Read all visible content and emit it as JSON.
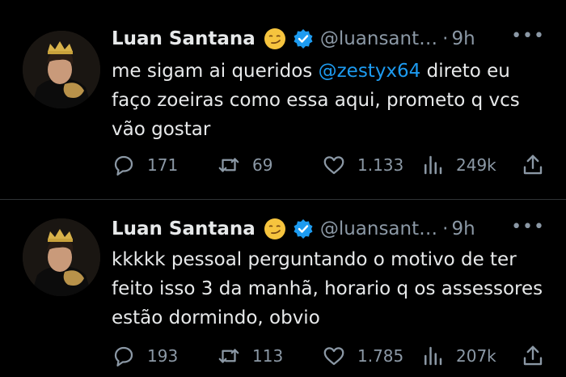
{
  "colors": {
    "background": "#000000",
    "text": "#e7e9ea",
    "muted": "#8b98a5",
    "accent": "#1d9bf0"
  },
  "tweets": [
    {
      "author": {
        "name": "Luan Santana",
        "emoji": "smirking-face-emoji",
        "verified": true,
        "handle": "@luansant…",
        "separator": "·",
        "time": "9h"
      },
      "more": "•••",
      "text_before": "me sigam ai queridos ",
      "mention": "@zestyx64",
      "text_after": " direto eu faço zoeiras como essa aqui, prometo q vcs vão gostar",
      "stats": {
        "replies": "171",
        "retweets": "69",
        "likes": "1.133",
        "views": "249k"
      }
    },
    {
      "author": {
        "name": "Luan Santana",
        "emoji": "smirking-face-emoji",
        "verified": true,
        "handle": "@luansant…",
        "separator": "·",
        "time": "9h"
      },
      "more": "•••",
      "text": "kkkkk pessoal perguntando o motivo de ter feito isso 3 da manhã, horario q os assessores estão dormindo, obvio",
      "stats": {
        "replies": "193",
        "retweets": "113",
        "likes": "1.785",
        "views": "207k"
      }
    }
  ]
}
